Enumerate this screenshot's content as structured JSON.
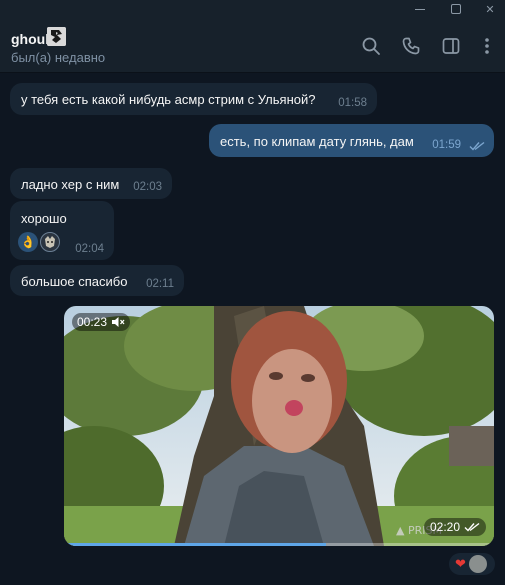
{
  "window": {
    "controls": [
      "minimize-icon",
      "maximize-icon",
      "close-icon"
    ]
  },
  "header": {
    "peer_name": "ghoul",
    "status": "был(а) недавно",
    "actions": [
      "search-icon",
      "phone-icon",
      "sidebar-toggle-icon",
      "more-vertical-icon"
    ]
  },
  "messages": [
    {
      "direction": "in",
      "text": "у тебя есть какой нибудь асмр стрим с Ульяной?",
      "time": "01:58"
    },
    {
      "direction": "out",
      "text": "есть, по клипам дату глянь, дам",
      "time": "01:59",
      "read": true
    },
    {
      "direction": "in",
      "text": "ладно хер с ним",
      "time": "02:03"
    },
    {
      "direction": "in",
      "text": "хорошо",
      "time": "02:04",
      "reactions": [
        "👌",
        "avatar"
      ]
    },
    {
      "direction": "in",
      "text": "большое спасибо",
      "time": "02:11"
    }
  ],
  "video": {
    "elapsed": "00:23",
    "muted": true,
    "sent_time": "02:20",
    "read": true,
    "progress": 0.61
  },
  "reaction_bar": {
    "emoji": "❤",
    "icon": "heart-icon"
  },
  "colors": {
    "background": "#0e1621",
    "header": "#17212b",
    "incoming_bubble": "#182533",
    "outgoing_bubble": "#2b5278",
    "accent": "#5fa6e8"
  }
}
